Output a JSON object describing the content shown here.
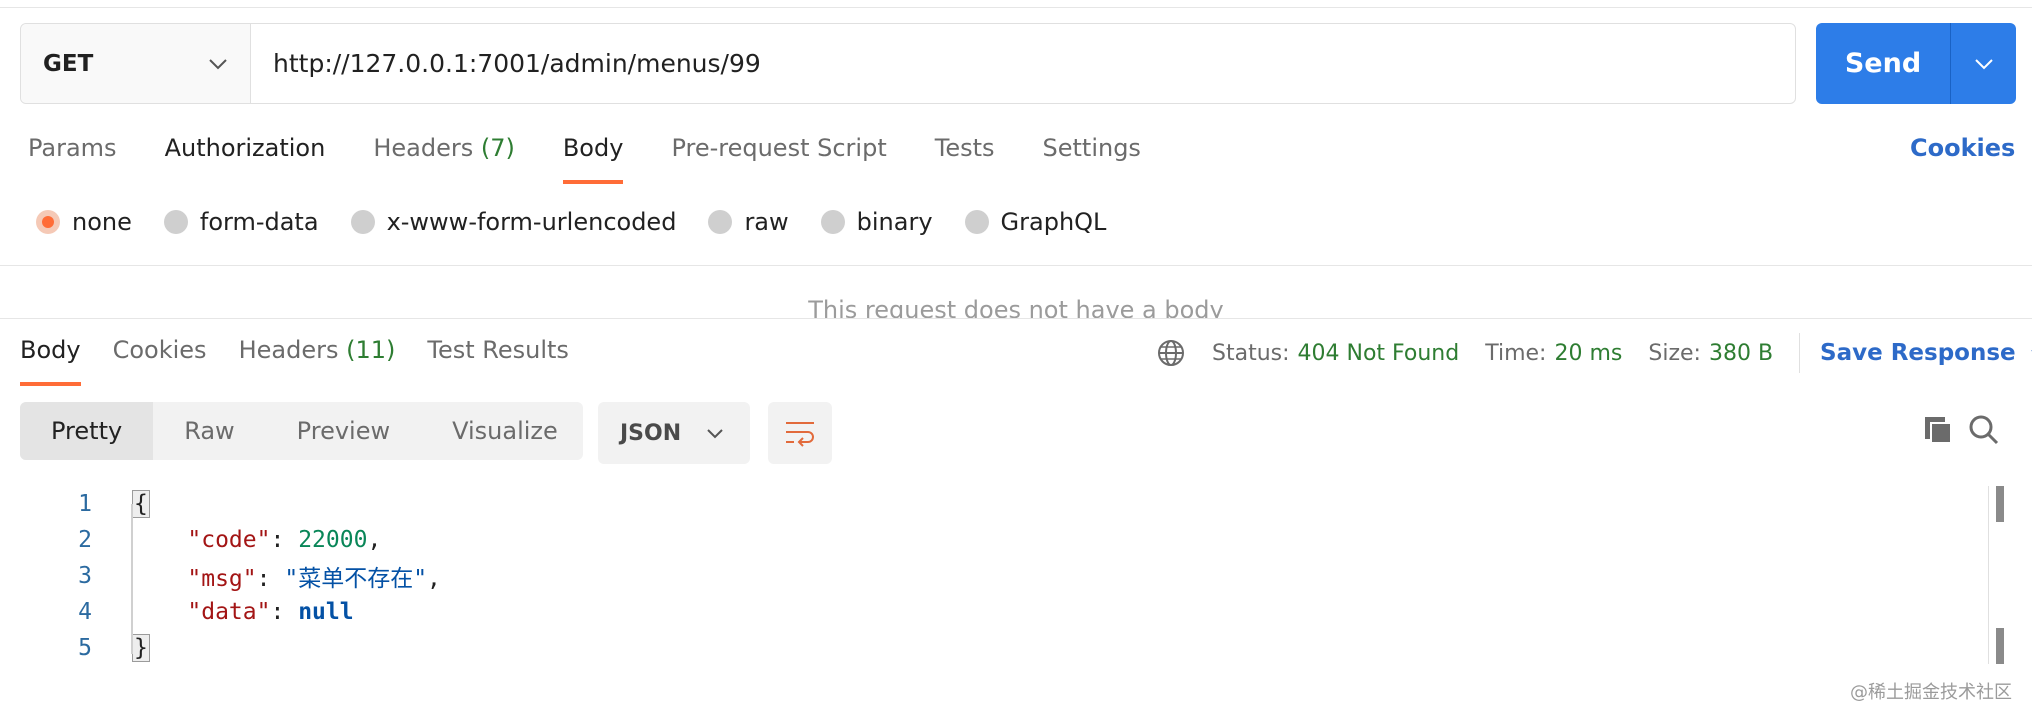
{
  "request": {
    "method": "GET",
    "url": "http://127.0.0.1:7001/admin/menus/99",
    "send_label": "Send"
  },
  "request_tabs": [
    {
      "label": "Params"
    },
    {
      "label": "Authorization"
    },
    {
      "label": "Headers",
      "count": "(7)"
    },
    {
      "label": "Body"
    },
    {
      "label": "Pre-request Script"
    },
    {
      "label": "Tests"
    },
    {
      "label": "Settings"
    }
  ],
  "cookies_link": "Cookies",
  "body_types": [
    "none",
    "form-data",
    "x-www-form-urlencoded",
    "raw",
    "binary",
    "GraphQL"
  ],
  "selected_body_type": "none",
  "no_body_message": "This request does not have a body",
  "response": {
    "tabs": [
      {
        "label": "Body"
      },
      {
        "label": "Cookies"
      },
      {
        "label": "Headers",
        "count": "(11)"
      },
      {
        "label": "Test Results"
      }
    ],
    "status_label": "Status:",
    "status_value": "404 Not Found",
    "time_label": "Time:",
    "time_value": "20 ms",
    "size_label": "Size:",
    "size_value": "380 B",
    "save_label": "Save Response",
    "view_modes": [
      "Pretty",
      "Raw",
      "Preview",
      "Visualize"
    ],
    "format": "JSON"
  },
  "code_lines": {
    "numbers": [
      "1",
      "2",
      "3",
      "4",
      "5"
    ],
    "open_brace": "{",
    "close_brace": "}",
    "code_key": "\"code\"",
    "code_value": "22000",
    "msg_key": "\"msg\"",
    "msg_value": "\"菜单不存在\"",
    "data_key": "\"data\"",
    "data_value": "null"
  },
  "watermark": "@稀土掘金技术社区",
  "colors": {
    "accent_orange": "#ff6c37",
    "send_blue": "#2d7de8",
    "link_blue": "#2d6ac8",
    "status_green": "#2e7d32"
  }
}
